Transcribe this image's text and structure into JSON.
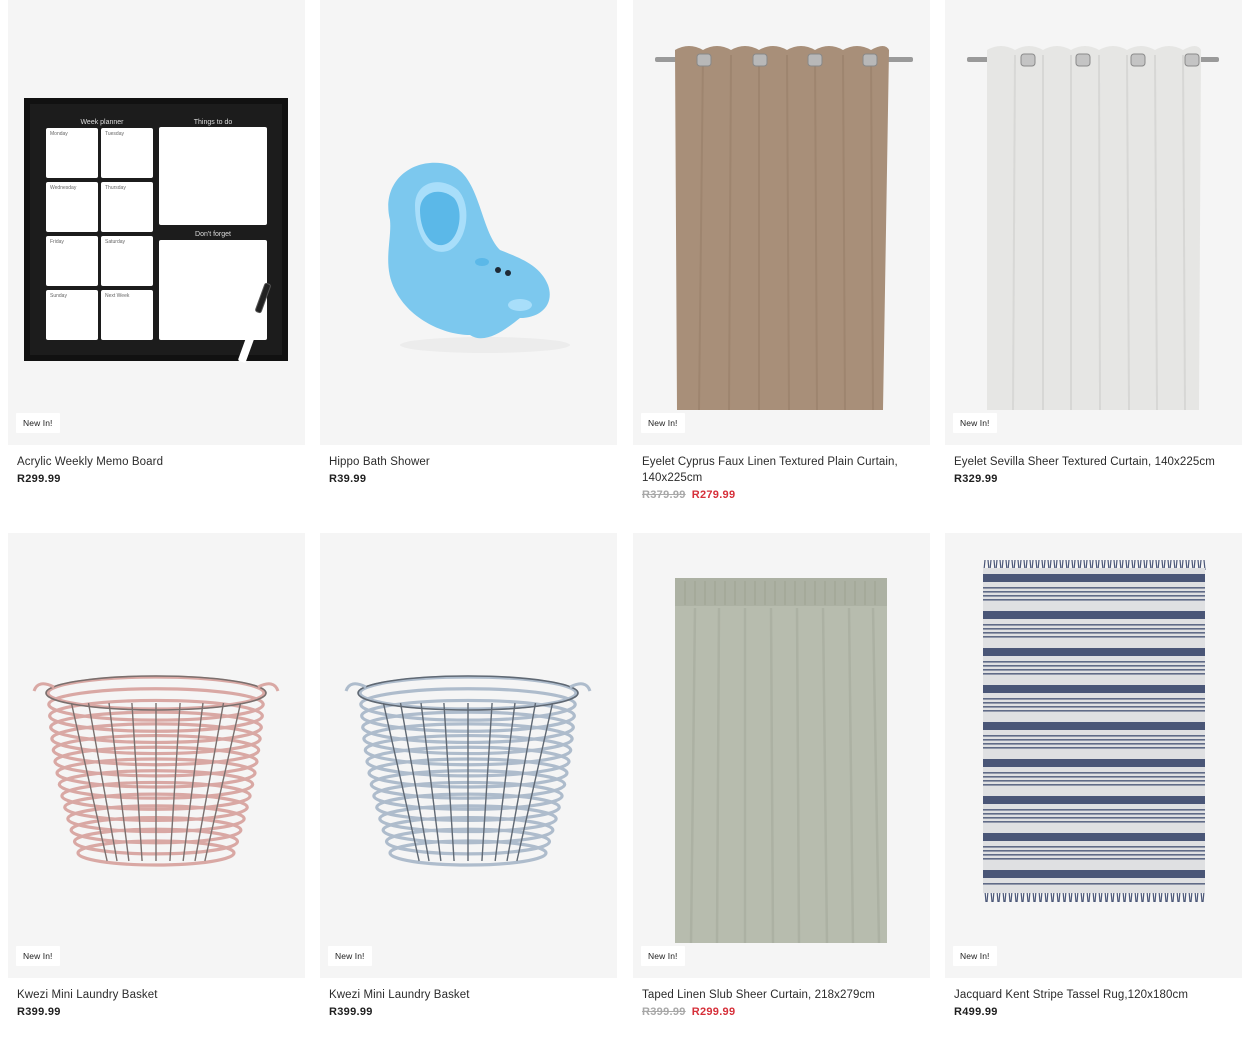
{
  "products": [
    {
      "badge": "New In!",
      "name": "Acrylic Weekly Memo Board",
      "price": "R299.99",
      "old_price": "",
      "sale_price": "",
      "board": {
        "heading_left": "Week planner",
        "heading_right": "Things to do",
        "heading_bottom": "Don't forget",
        "days": [
          "Monday",
          "Tuesday",
          "Wednesday",
          "Thursday",
          "Friday",
          "Saturday",
          "Sunday",
          "Next Week"
        ]
      }
    },
    {
      "badge": "",
      "name": "Hippo Bath Shower",
      "price": "R39.99",
      "old_price": "",
      "sale_price": ""
    },
    {
      "badge": "New In!",
      "name": "Eyelet Cyprus Faux Linen Textured Plain Curtain, 140x225cm",
      "price": "",
      "old_price": "R379.99",
      "sale_price": "R279.99"
    },
    {
      "badge": "New In!",
      "name": "Eyelet Sevilla Sheer Textured Curtain, 140x225cm",
      "price": "R329.99",
      "old_price": "",
      "sale_price": ""
    },
    {
      "badge": "New In!",
      "name": "Kwezi Mini Laundry Basket",
      "price": "R399.99",
      "old_price": "",
      "sale_price": ""
    },
    {
      "badge": "New In!",
      "name": "Kwezi Mini Laundry Basket",
      "price": "R399.99",
      "old_price": "",
      "sale_price": ""
    },
    {
      "badge": "New In!",
      "name": "Taped Linen Slub Sheer Curtain, 218x279cm",
      "price": "",
      "old_price": "R399.99",
      "sale_price": "R299.99"
    },
    {
      "badge": "New In!",
      "name": "Jacquard Kent Stripe Tassel Rug,120x180cm",
      "price": "R499.99",
      "old_price": "",
      "sale_price": ""
    }
  ],
  "colors": {
    "image_bg": "#f5f5f5",
    "sale_price": "#d6303a",
    "old_price": "#a8a8a8",
    "curtain_brown": "#a88f79",
    "curtain_white": "#e6e6e4",
    "curtain_sage": "#b7bcae",
    "basket_pink": "#d9a8a4",
    "basket_blue": "#aebccc",
    "hippo_blue": "#7cc8ee",
    "rug_navy": "#4a5677"
  }
}
